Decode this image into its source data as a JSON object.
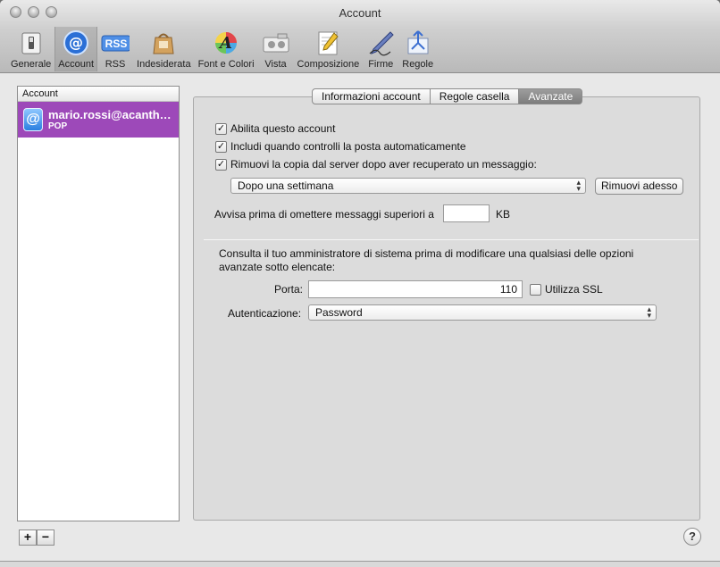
{
  "window": {
    "title": "Account"
  },
  "toolbar": {
    "items": [
      {
        "label": "Generale",
        "icon": "switch-icon"
      },
      {
        "label": "Account",
        "icon": "at-sign-icon",
        "selected": true
      },
      {
        "label": "RSS",
        "icon": "rss-icon"
      },
      {
        "label": "Indesiderata",
        "icon": "junk-bag-icon"
      },
      {
        "label": "Font e Colori",
        "icon": "font-colors-icon"
      },
      {
        "label": "Vista",
        "icon": "view-icon"
      },
      {
        "label": "Composizione",
        "icon": "compose-icon"
      },
      {
        "label": "Firme",
        "icon": "pen-signature-icon"
      },
      {
        "label": "Regole",
        "icon": "rules-icon"
      }
    ]
  },
  "sidebar": {
    "header": "Account",
    "accounts": [
      {
        "name": "mario.rossi@acanth…",
        "type": "POP"
      }
    ],
    "add_label": "+",
    "remove_label": "−"
  },
  "tabs": [
    {
      "label": "Informazioni account",
      "active": false
    },
    {
      "label": "Regole casella",
      "active": false
    },
    {
      "label": "Avanzate",
      "active": true
    }
  ],
  "advanced": {
    "enable_account": {
      "label": "Abilita questo account",
      "checked": true
    },
    "include_auto_check": {
      "label": "Includi quando controlli la posta automaticamente",
      "checked": true
    },
    "remove_copy": {
      "label": "Rimuovi la copia dal server dopo aver recuperato un messaggio:",
      "checked": true
    },
    "remove_when": "Dopo una settimana",
    "remove_now_label": "Rimuovi adesso",
    "warn_label": "Avvisa prima di omettere messaggi superiori a",
    "warn_value": "",
    "warn_unit": "KB",
    "admin_note": "Consulta il tuo amministratore di sistema prima di modificare una qualsiasi delle opzioni avanzate sotto elencate:",
    "port_label": "Porta:",
    "port_value": "110",
    "ssl": {
      "label": "Utilizza SSL",
      "checked": false
    },
    "auth_label": "Autenticazione:",
    "auth_value": "Password"
  },
  "help_label": "?",
  "colors": {
    "selection": "#9d49b9",
    "accent_blue": "#2c7fe0"
  }
}
